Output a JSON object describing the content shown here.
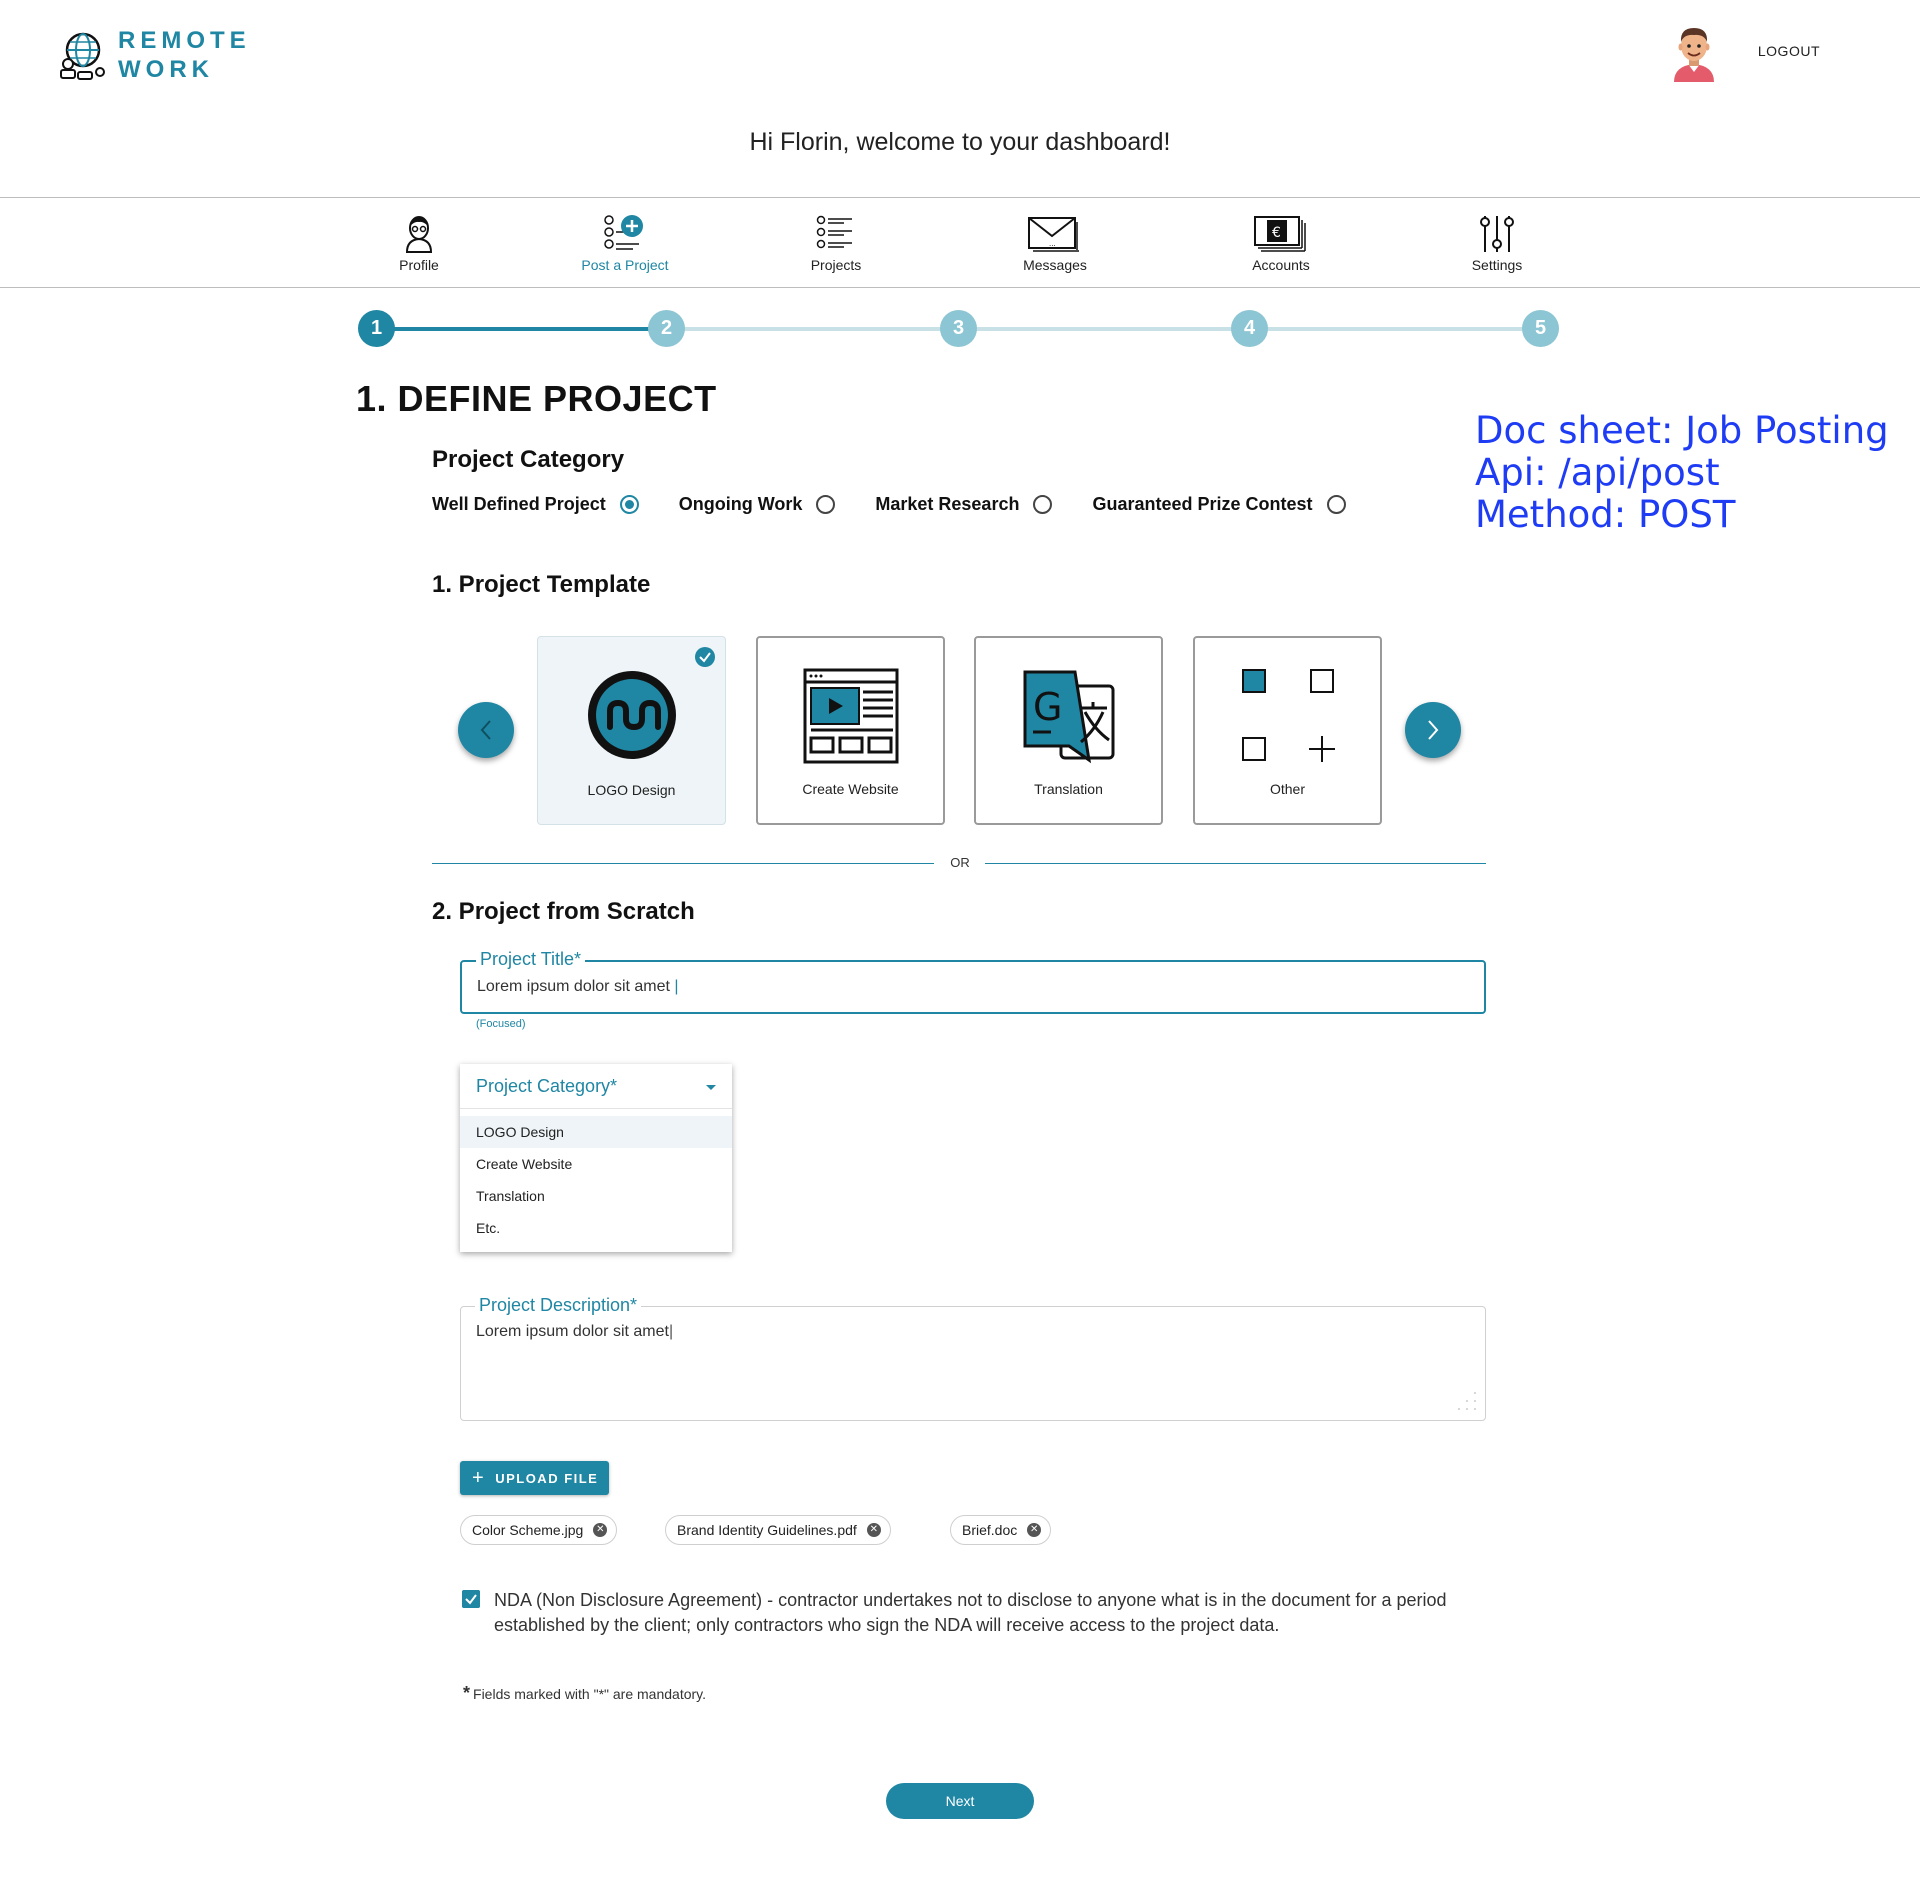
{
  "header": {
    "logo_line1": "REMOTE",
    "logo_line2": "WORK",
    "logout_label": "LOGOUT",
    "welcome": "Hi Florin, welcome to your dashboard!"
  },
  "nav": {
    "items": [
      {
        "label": "Profile",
        "icon": "profile-icon"
      },
      {
        "label": "Post a Project",
        "icon": "post-project-icon",
        "active": true
      },
      {
        "label": "Projects",
        "icon": "projects-list-icon"
      },
      {
        "label": "Messages",
        "icon": "envelope-icon"
      },
      {
        "label": "Accounts",
        "icon": "money-icon"
      },
      {
        "label": "Settings",
        "icon": "sliders-icon"
      }
    ]
  },
  "stepper": {
    "steps": [
      "1",
      "2",
      "3",
      "4",
      "5"
    ],
    "current_step": 1
  },
  "page": {
    "title": "1. DEFINE PROJECT"
  },
  "doc_note": {
    "line1": "Doc sheet: Job Posting",
    "line2": "Api: /api/post",
    "line3": "Method: POST"
  },
  "category": {
    "heading": "Project Category",
    "options": [
      {
        "label": "Well Defined Project",
        "selected": true
      },
      {
        "label": "Ongoing Work",
        "selected": false
      },
      {
        "label": "Market Research",
        "selected": false
      },
      {
        "label": "Guaranteed Prize Contest",
        "selected": false
      }
    ]
  },
  "templates": {
    "heading": "1. Project Template",
    "cards": [
      {
        "label": "LOGO Design",
        "icon": "logo-design-icon",
        "selected": true
      },
      {
        "label": "Create Website",
        "icon": "website-icon",
        "selected": false
      },
      {
        "label": "Translation",
        "icon": "translate-icon",
        "selected": false
      },
      {
        "label": "Other",
        "icon": "other-icon",
        "selected": false
      }
    ],
    "or_label": "OR"
  },
  "scratch": {
    "heading": "2. Project from Scratch",
    "title_field": {
      "label": "Project Title*",
      "value": "Lorem ipsum dolor sit amet ",
      "helper": "(Focused)"
    },
    "category_field": {
      "label": "Project Category*",
      "options": [
        "LOGO Design",
        "Create Website",
        "Translation",
        "Etc."
      ]
    },
    "description_field": {
      "label": "Project Description*",
      "value": "Lorem ipsum dolor sit amet"
    },
    "upload_label": "UPLOAD FILE",
    "files": [
      "Color Scheme.jpg",
      "Brand Identity Guidelines.pdf",
      "Brief.doc"
    ],
    "nda_text": "NDA (Non Disclosure Agreement) - contractor undertakes not to disclose to anyone what is in the document for a period established by the client; only contractors who sign the NDA will receive access to the project data.",
    "nda_checked": true,
    "mandatory_star": "*",
    "mandatory_note": "Fields marked with \"*\" are mandatory.",
    "next_label": "Next"
  },
  "colors": {
    "accent": "#1f86a3",
    "step_inactive": "#8cc5d3",
    "note_blue": "#1f3cf5"
  }
}
